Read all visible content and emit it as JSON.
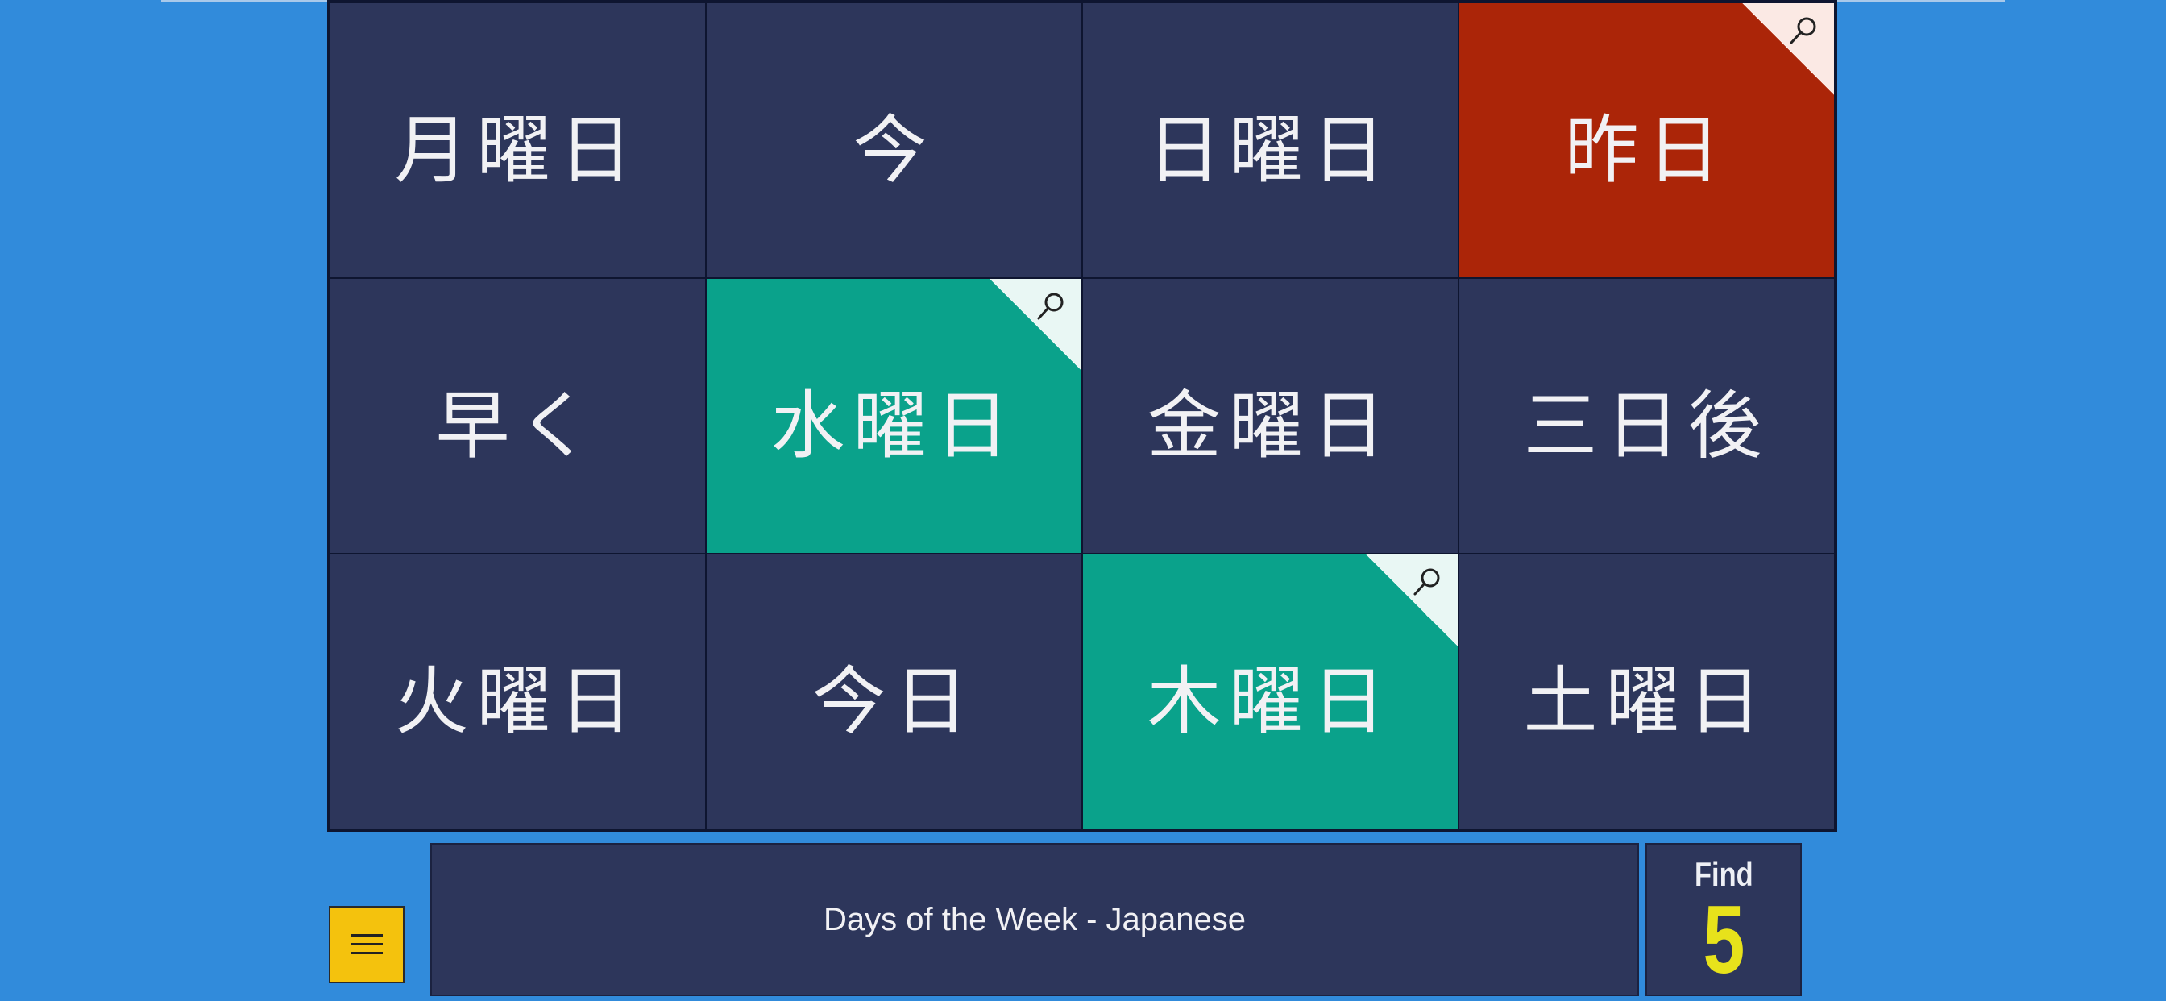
{
  "game": {
    "title": "Days of the Week - Japanese",
    "find_label": "Find",
    "find_count": "5"
  },
  "colors": {
    "background": "#318bdb",
    "tile_default": "#2d365b",
    "tile_correct": "#0aa28b",
    "tile_wrong": "#ab2508",
    "menu_button": "#f4c20d",
    "find_count": "#e7e21b"
  },
  "tiles": [
    {
      "label": "月曜日",
      "state": "default",
      "flagged": false
    },
    {
      "label": "今",
      "state": "default",
      "flagged": false
    },
    {
      "label": "日曜日",
      "state": "default",
      "flagged": false
    },
    {
      "label": "昨日",
      "state": "wrong",
      "flagged": true
    },
    {
      "label": "早く",
      "state": "default",
      "flagged": false
    },
    {
      "label": "水曜日",
      "state": "correct",
      "flagged": true
    },
    {
      "label": "金曜日",
      "state": "default",
      "flagged": false
    },
    {
      "label": "三日後",
      "state": "default",
      "flagged": false
    },
    {
      "label": "火曜日",
      "state": "default",
      "flagged": false
    },
    {
      "label": "今日",
      "state": "default",
      "flagged": false
    },
    {
      "label": "木曜日",
      "state": "correct",
      "flagged": true
    },
    {
      "label": "土曜日",
      "state": "default",
      "flagged": false
    }
  ],
  "icons": {
    "menu": "hamburger-menu-icon",
    "flag": "magnifier-icon"
  }
}
